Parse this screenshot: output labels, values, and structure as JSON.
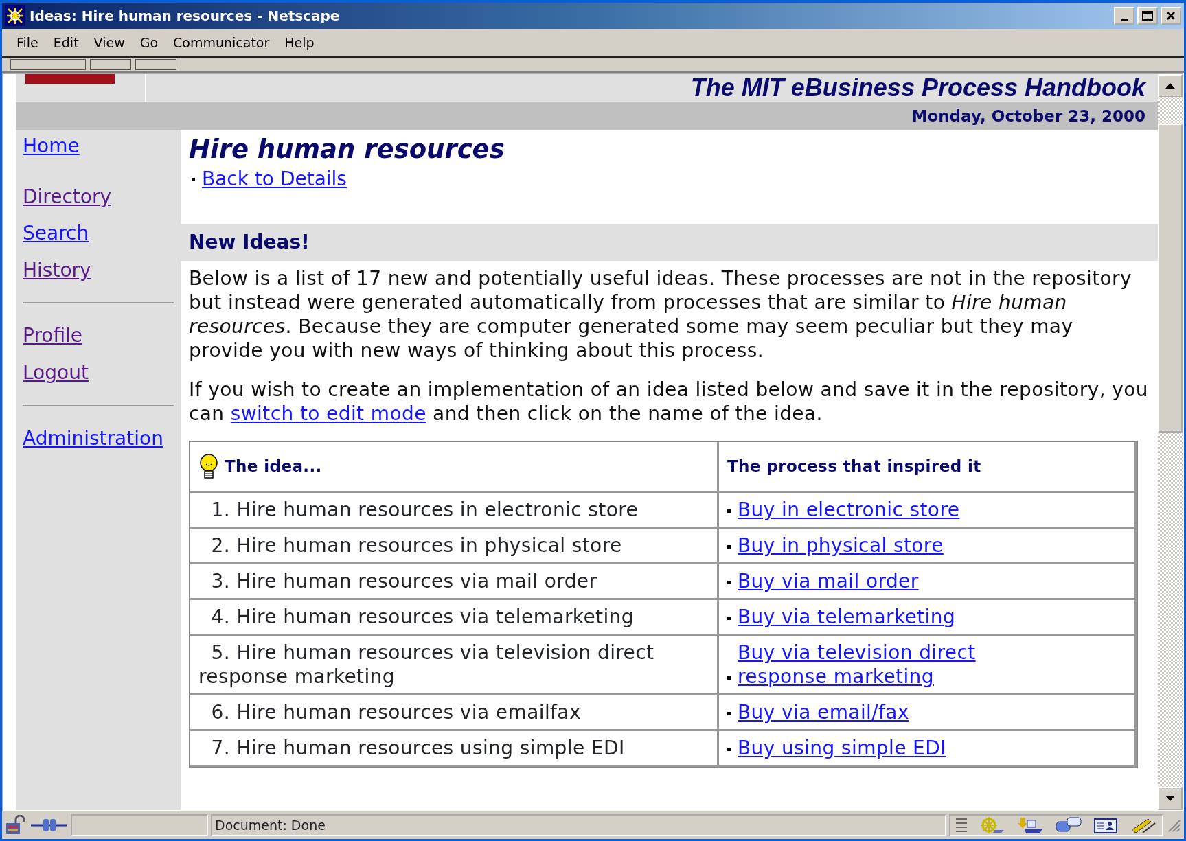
{
  "window": {
    "title": "Ideas: Hire human resources - Netscape"
  },
  "menu": [
    "File",
    "Edit",
    "View",
    "Go",
    "Communicator",
    "Help"
  ],
  "banner": {
    "title": "The MIT eBusiness Process Handbook",
    "date": "Monday, October 23, 2000"
  },
  "sidebar": {
    "groups": [
      [
        {
          "label": "Home",
          "visited": false
        },
        {
          "label": "Directory",
          "visited": true
        },
        {
          "label": "Search",
          "visited": false
        },
        {
          "label": "History",
          "visited": true
        }
      ],
      [
        {
          "label": "Profile",
          "visited": true
        },
        {
          "label": "Logout",
          "visited": true
        }
      ],
      [
        {
          "label": "Administration",
          "visited": false
        }
      ]
    ]
  },
  "main": {
    "heading": "Hire human resources",
    "back_link": "Back to Details",
    "section_title": "New Ideas!",
    "intro": "Below is a list of 17 new and potentially useful ideas. These processes are not in the repository but instead were generated automatically from processes that are similar to *Hire human resources*. Because they are computer generated some may seem peculiar but they may provide you with new ways of thinking about this process.",
    "edit_note": {
      "before": "If you wish to create an implementation of an idea listed below and save it in the repository, you can",
      "link": "switch to edit mode",
      "after": "and then click on the name of the idea."
    }
  },
  "table": {
    "columns": [
      "The idea...",
      "The process that inspired it"
    ],
    "rows": [
      {
        "number": "1.",
        "idea": "Hire human resources in electronic store",
        "process": "Buy in electronic store"
      },
      {
        "number": "2.",
        "idea": "Hire human resources in physical store",
        "process": "Buy in physical store"
      },
      {
        "number": "3.",
        "idea": "Hire human resources via mail order",
        "process": "Buy via mail order"
      },
      {
        "number": "4.",
        "idea": "Hire human resources via telemarketing",
        "process": "Buy via telemarketing"
      },
      {
        "number": "5.",
        "idea": "Hire human resources via television direct response marketing",
        "process": "Buy via television direct response marketing"
      },
      {
        "number": "6.",
        "idea": "Hire human resources via emailfax",
        "process": "Buy via email/fax"
      },
      {
        "number": "7.",
        "idea": "Hire human resources using simple EDI",
        "process": "Buy using simple EDI"
      }
    ]
  },
  "status_bar": {
    "text": "Document: Done"
  }
}
